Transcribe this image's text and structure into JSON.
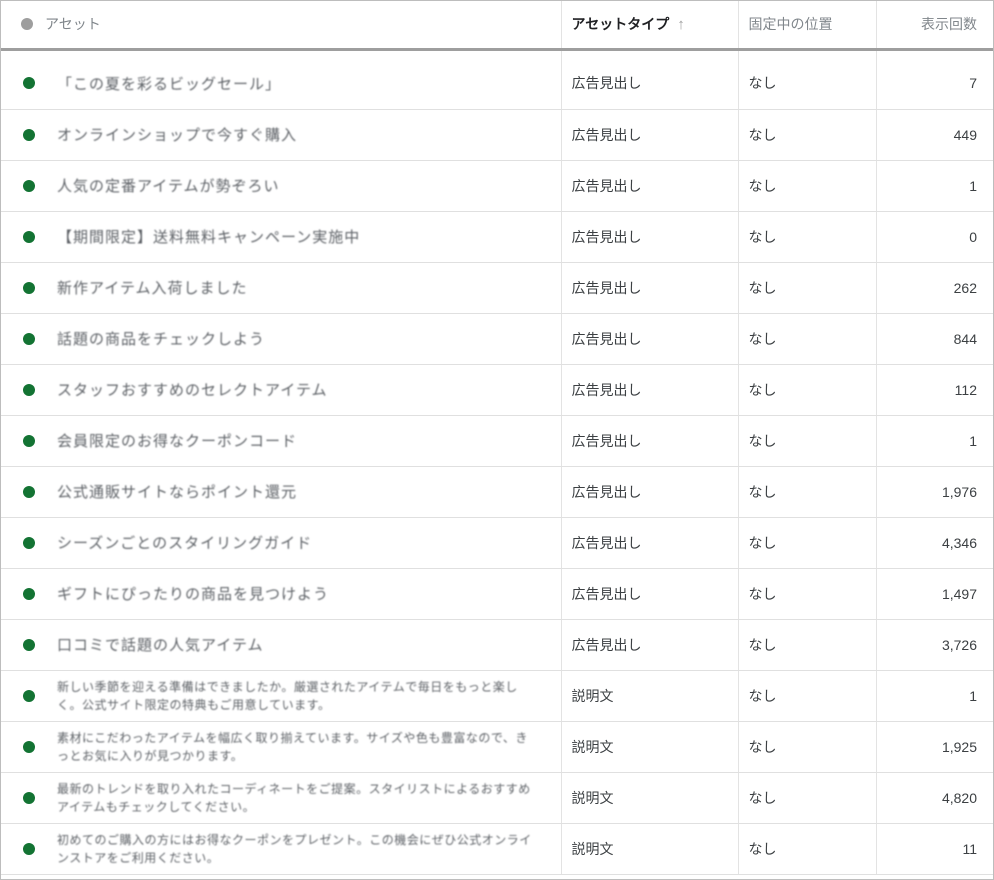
{
  "header": {
    "asset": "アセット",
    "asset_type": "アセットタイプ",
    "sort_indicator": "↑",
    "pinned_position": "固定中の位置",
    "impressions": "表示回数"
  },
  "colors": {
    "status_enabled": "#137333",
    "header_dot": "#9e9e9e"
  },
  "rows": [
    {
      "asset": "「この夏を彩るビッグセール」",
      "type": "広告見出し",
      "pinned": "なし",
      "impressions": "7"
    },
    {
      "asset": "オンラインショップで今すぐ購入",
      "type": "広告見出し",
      "pinned": "なし",
      "impressions": "449"
    },
    {
      "asset": "人気の定番アイテムが勢ぞろい",
      "type": "広告見出し",
      "pinned": "なし",
      "impressions": "1"
    },
    {
      "asset": "【期間限定】送料無料キャンペーン実施中",
      "type": "広告見出し",
      "pinned": "なし",
      "impressions": "0"
    },
    {
      "asset": "新作アイテム入荷しました",
      "type": "広告見出し",
      "pinned": "なし",
      "impressions": "262"
    },
    {
      "asset": "話題の商品をチェックしよう",
      "type": "広告見出し",
      "pinned": "なし",
      "impressions": "844"
    },
    {
      "asset": "スタッフおすすめのセレクトアイテム",
      "type": "広告見出し",
      "pinned": "なし",
      "impressions": "112"
    },
    {
      "asset": "会員限定のお得なクーポンコード",
      "type": "広告見出し",
      "pinned": "なし",
      "impressions": "1"
    },
    {
      "asset": "公式通販サイトならポイント還元",
      "type": "広告見出し",
      "pinned": "なし",
      "impressions": "1,976"
    },
    {
      "asset": "シーズンごとのスタイリングガイド",
      "type": "広告見出し",
      "pinned": "なし",
      "impressions": "4,346"
    },
    {
      "asset": "ギフトにぴったりの商品を見つけよう",
      "type": "広告見出し",
      "pinned": "なし",
      "impressions": "1,497"
    },
    {
      "asset": "口コミで話題の人気アイテム",
      "type": "広告見出し",
      "pinned": "なし",
      "impressions": "3,726"
    },
    {
      "asset": "新しい季節を迎える準備はできましたか。厳選されたアイテムで毎日をもっと楽しく。公式サイト限定の特典もご用意しています。",
      "type": "説明文",
      "pinned": "なし",
      "impressions": "1"
    },
    {
      "asset": "素材にこだわったアイテムを幅広く取り揃えています。サイズや色も豊富なので、きっとお気に入りが見つかります。",
      "type": "説明文",
      "pinned": "なし",
      "impressions": "1,925"
    },
    {
      "asset": "最新のトレンドを取り入れたコーディネートをご提案。スタイリストによるおすすめアイテムもチェックしてください。",
      "type": "説明文",
      "pinned": "なし",
      "impressions": "4,820"
    },
    {
      "asset": "初めてのご購入の方にはお得なクーポンをプレゼント。この機会にぜひ公式オンラインストアをご利用ください。",
      "type": "説明文",
      "pinned": "なし",
      "impressions": "11"
    }
  ]
}
